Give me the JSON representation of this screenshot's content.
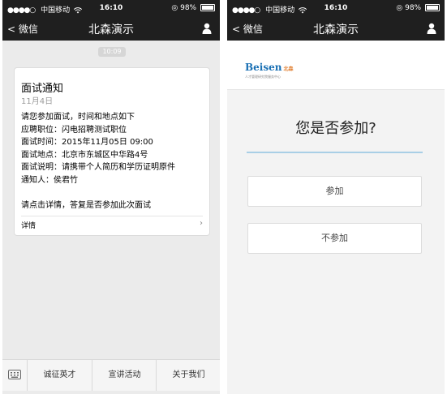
{
  "status": {
    "carrier_left": "中国移动",
    "carrier_right": "中国移动",
    "time": "16:10",
    "battery": "98%"
  },
  "nav": {
    "back_label": "微信",
    "title": "北森演示"
  },
  "chat": {
    "date_pill": "10:09",
    "card": {
      "title": "面试通知",
      "date": "11月4日",
      "lines": [
        "请您参加面试，时间和地点如下",
        "应聘职位：闪电招聘测试职位",
        "面试时间：2015年11月05日 09:00",
        "面试地点：北京市东城区中华路4号",
        "面试说明：请携带个人简历和学历证明原件",
        "通知人：侯君竹"
      ],
      "prompt": "请点击详情，答复是否参加此次面试",
      "detail_label": "详情",
      "chevron": "›"
    }
  },
  "menu": {
    "items": [
      "诚征英才",
      "宣讲活动",
      "关于我们"
    ]
  },
  "rsvp": {
    "brand_main": "Beisen",
    "brand_sub": "北森",
    "brand_tag": "人才管理研究院服务中心",
    "question": "您是否参加?",
    "accept_label": "参加",
    "decline_label": "不参加"
  },
  "colors": {
    "nav_bg": "#1f1f1f",
    "brand_blue": "#1a70b4",
    "brand_orange": "#e07c2c",
    "input_line": "#a9cfe6"
  },
  "icons": {
    "back": "chevron-left-icon",
    "user": "user-icon",
    "keyboard": "keyboard-icon",
    "wifi": "wifi-icon",
    "battery": "battery-icon"
  }
}
